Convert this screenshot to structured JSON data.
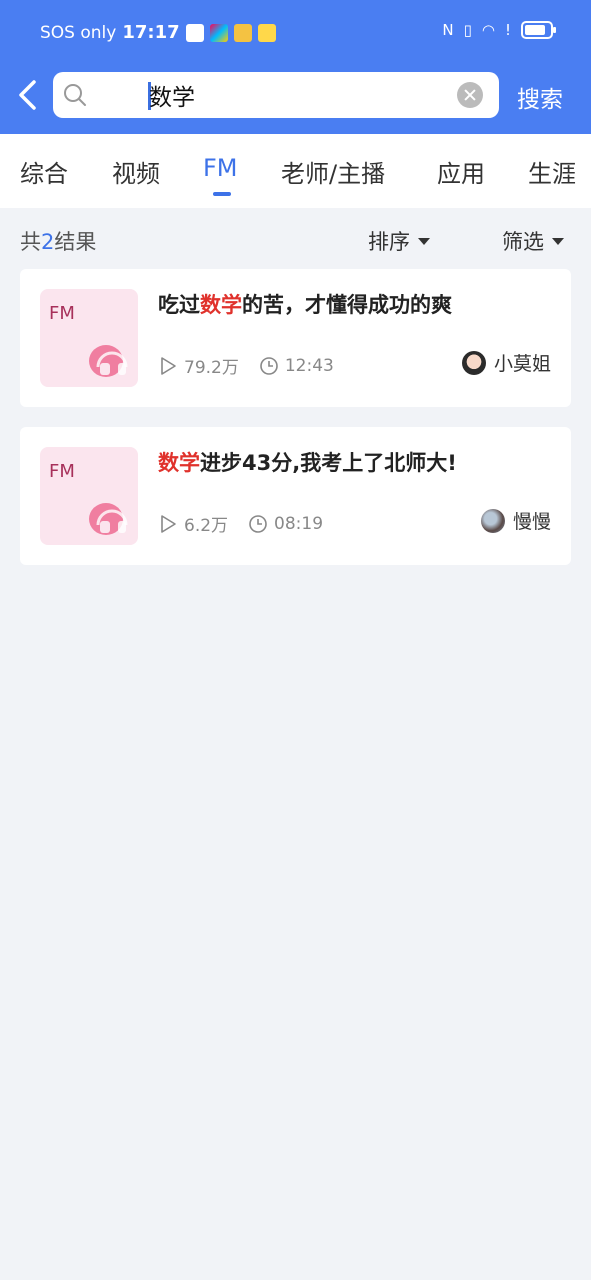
{
  "status_bar": {
    "carrier": "SOS only",
    "time": "17:17"
  },
  "search": {
    "query": "数学",
    "button_label": "搜索"
  },
  "tabs": [
    {
      "label": "综合"
    },
    {
      "label": "视频"
    },
    {
      "label": "FM"
    },
    {
      "label": "老师/主播"
    },
    {
      "label": "应用"
    },
    {
      "label": "生涯"
    }
  ],
  "results": {
    "count_prefix": "共",
    "count": "2",
    "count_suffix": "结果",
    "sort_label": "排序",
    "filter_label": "筛选",
    "items": [
      {
        "thumb_label": "FM",
        "title_pre": "吃过",
        "title_hl": "数学",
        "title_post": "的苦，才懂得成功的爽",
        "plays": "79.2万",
        "duration": "12:43",
        "author": "小莫姐"
      },
      {
        "thumb_label": "FM",
        "title_pre": "",
        "title_hl": "数学",
        "title_post": "进步43分,我考上了北师大!",
        "plays": "6.2万",
        "duration": "08:19",
        "author": "慢慢"
      }
    ]
  },
  "colors": {
    "header": "#4a7ef2",
    "accent": "#3d72e8",
    "highlight": "#e0322c"
  }
}
